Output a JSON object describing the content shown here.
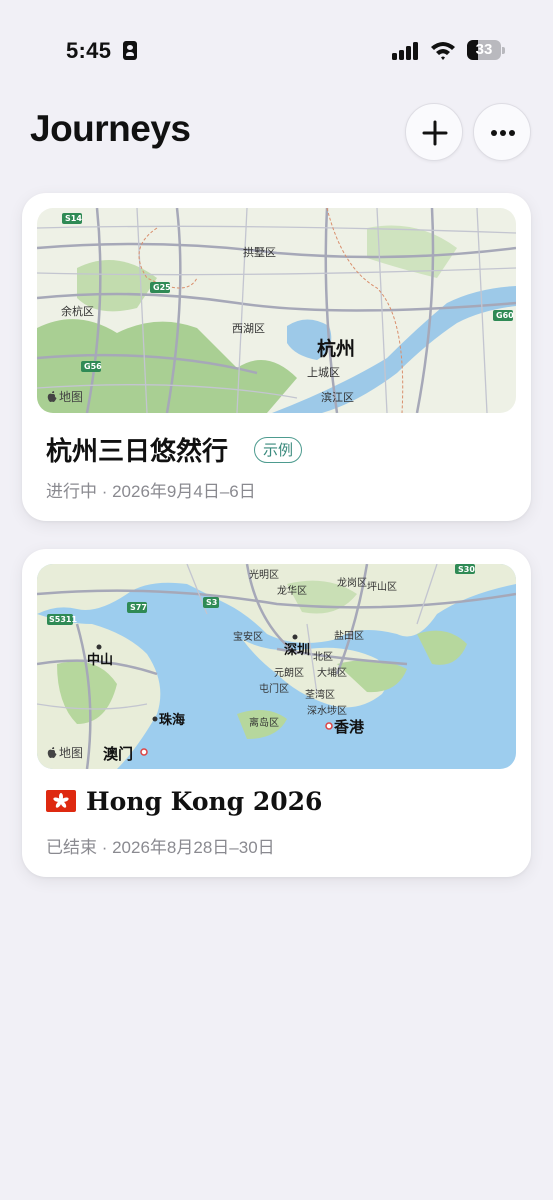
{
  "status_bar": {
    "time": "5:45",
    "battery_level": "33",
    "battery_percent": 33
  },
  "header": {
    "title": "Journeys",
    "add_icon": "plus-icon",
    "more_icon": "ellipsis-icon"
  },
  "journeys": [
    {
      "title": "杭州三日悠然行",
      "badge": "示例",
      "subtitle": "进行中 · 2026年9月4日–6日",
      "map": {
        "attribution": "地图",
        "labels": [
          "拱墅区",
          "余杭区",
          "西湖区",
          "杭州",
          "上城区",
          "滨江区"
        ],
        "shields": [
          "S14",
          "G25",
          "G56",
          "G60"
        ]
      }
    },
    {
      "title": "Hong Kong 2026",
      "flag_icon": "hong-kong-flag-icon",
      "subtitle": "已结束 · 2026年8月28日–30日",
      "map": {
        "attribution": "地图",
        "labels": [
          "光明区",
          "龙华区",
          "龙岗区",
          "坪山区",
          "宝安区",
          "深圳",
          "盐田区",
          "中山",
          "元朗区",
          "北区",
          "屯门区",
          "大埔区",
          "荃湾区",
          "珠海",
          "离岛区",
          "深水埗区",
          "香港",
          "澳门"
        ],
        "shields": [
          "S3",
          "S77",
          "S5311",
          "S30"
        ]
      }
    }
  ]
}
